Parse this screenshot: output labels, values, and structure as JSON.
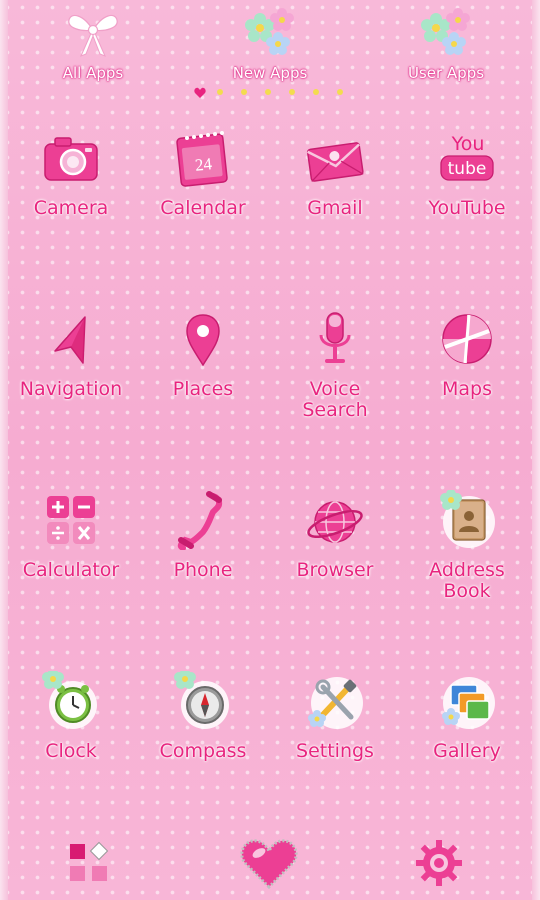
{
  "tabs": [
    {
      "label": "All Apps",
      "icon": "bow-icon"
    },
    {
      "label": "New Apps",
      "icon": "flowers-icon"
    },
    {
      "label": "User Apps",
      "icon": "flowers-icon"
    }
  ],
  "pager": {
    "pages": 7,
    "current": 0
  },
  "apps": [
    {
      "label": "Camera",
      "icon": "camera-icon"
    },
    {
      "label": "Calendar",
      "icon": "calendar-icon",
      "icon_text": "24"
    },
    {
      "label": "Gmail",
      "icon": "mail-icon"
    },
    {
      "label": "YouTube",
      "icon": "youtube-icon",
      "icon_text_top": "You",
      "icon_text_bottom": "tube"
    },
    {
      "label": "Navigation",
      "icon": "navigation-arrow-icon"
    },
    {
      "label": "Places",
      "icon": "map-pin-icon"
    },
    {
      "label": "Voice\nSearch",
      "icon": "microphone-icon"
    },
    {
      "label": "Maps",
      "icon": "maps-icon"
    },
    {
      "label": "Calculator",
      "icon": "calculator-icon"
    },
    {
      "label": "Phone",
      "icon": "phone-handset-icon"
    },
    {
      "label": "Browser",
      "icon": "globe-icon"
    },
    {
      "label": "Address\nBook",
      "icon": "address-book-icon"
    },
    {
      "label": "Clock",
      "icon": "clock-icon"
    },
    {
      "label": "Compass",
      "icon": "compass-icon"
    },
    {
      "label": "Settings",
      "icon": "settings-tools-icon"
    },
    {
      "label": "Gallery",
      "icon": "gallery-icon"
    }
  ],
  "dock": [
    {
      "icon": "app-drawer-icon"
    },
    {
      "icon": "heart-icon"
    },
    {
      "icon": "gear-icon"
    }
  ],
  "colors": {
    "accent": "#e8247f",
    "background": "#f7b3d5",
    "dot": "#f3dc4f"
  }
}
